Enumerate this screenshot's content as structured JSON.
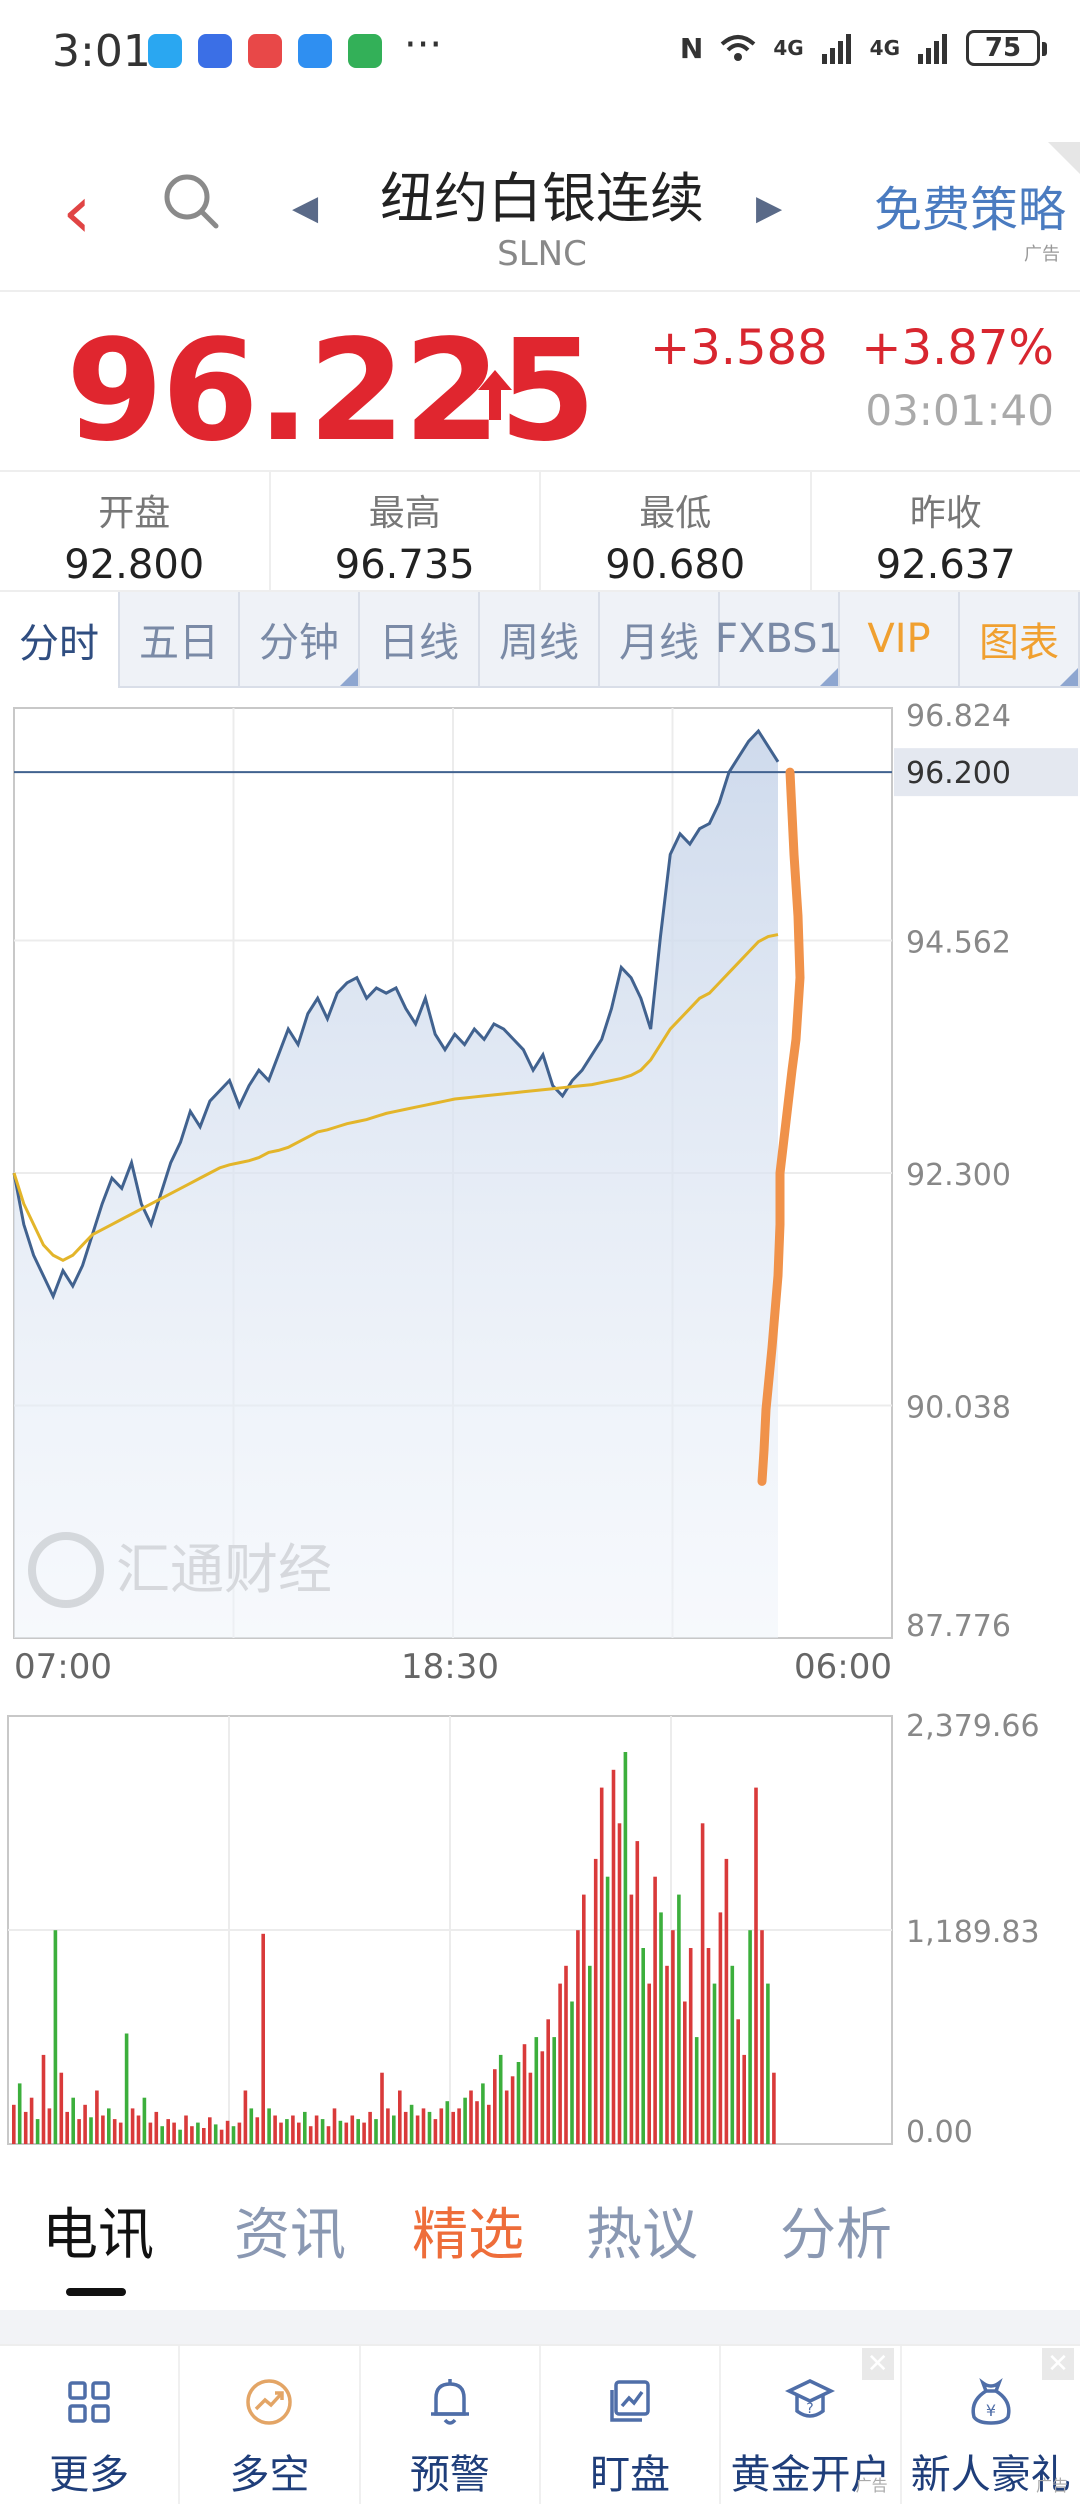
{
  "status": {
    "time": "3:01",
    "more": "···",
    "battery": "75",
    "signal_label": "4G",
    "app_colors": [
      "#2aa7f1",
      "#3b6fe6",
      "#e84848",
      "#2f8ff1",
      "#33b058"
    ]
  },
  "header": {
    "title": "纽约白银连续",
    "code": "SLNC",
    "promo": "免费策略",
    "promo_ad": "广告"
  },
  "quote": {
    "price": "96.225",
    "change": "+3.588",
    "change_pct": "+3.87%",
    "time": "03:01:40"
  },
  "stats": [
    {
      "label": "开盘",
      "value": "92.800"
    },
    {
      "label": "最高",
      "value": "96.735"
    },
    {
      "label": "最低",
      "value": "90.680"
    },
    {
      "label": "昨收",
      "value": "92.637"
    }
  ],
  "tabs": [
    {
      "label": "分时",
      "active": true
    },
    {
      "label": "五日"
    },
    {
      "label": "分钟",
      "corner": true
    },
    {
      "label": "日线"
    },
    {
      "label": "周线"
    },
    {
      "label": "月线"
    },
    {
      "label": "FXBS1",
      "corner": true
    },
    {
      "label": "VIP",
      "gold": true
    },
    {
      "label": "图表",
      "gold": true,
      "corner": true
    }
  ],
  "chart_data": [
    {
      "type": "line",
      "y_ticks": [
        "96.824",
        "94.562",
        "92.300",
        "90.038",
        "87.776"
      ],
      "ylim": [
        87.776,
        96.824
      ],
      "x_ticks": [
        "07:00",
        "18:30",
        "06:00"
      ],
      "current_line": {
        "value": 96.2,
        "label": "96.200"
      },
      "watermark": "汇通财经",
      "series": [
        {
          "color": "#41628f",
          "values": [
            92.3,
            91.8,
            91.5,
            91.3,
            91.1,
            91.35,
            91.2,
            91.4,
            91.7,
            92.0,
            92.25,
            92.15,
            92.4,
            92.0,
            91.8,
            92.1,
            92.4,
            92.6,
            92.9,
            92.75,
            93.0,
            93.1,
            93.2,
            92.95,
            93.15,
            93.3,
            93.2,
            93.45,
            93.7,
            93.55,
            93.85,
            94.0,
            93.8,
            94.05,
            94.15,
            94.2,
            94.0,
            94.1,
            94.05,
            94.1,
            93.9,
            93.75,
            94.0,
            93.65,
            93.5,
            93.65,
            93.55,
            93.7,
            93.6,
            93.75,
            93.7,
            93.6,
            93.5,
            93.3,
            93.45,
            93.15,
            93.05,
            93.2,
            93.3,
            93.45,
            93.6,
            93.9,
            94.3,
            94.2,
            94.0,
            93.7,
            94.6,
            95.4,
            95.6,
            95.5,
            95.65,
            95.7,
            95.9,
            96.2,
            96.35,
            96.5,
            96.6,
            96.45,
            96.3
          ]
        },
        {
          "color": "#e3b52a",
          "values": [
            92.3,
            92.0,
            91.8,
            91.6,
            91.5,
            91.45,
            91.5,
            91.6,
            91.7,
            91.75,
            91.8,
            91.85,
            91.9,
            91.95,
            92.0,
            92.05,
            92.1,
            92.15,
            92.2,
            92.25,
            92.3,
            92.35,
            92.38,
            92.4,
            92.42,
            92.45,
            92.5,
            92.52,
            92.55,
            92.6,
            92.65,
            92.7,
            92.72,
            92.75,
            92.78,
            92.8,
            92.82,
            92.85,
            92.88,
            92.9,
            92.92,
            92.94,
            92.96,
            92.98,
            93.0,
            93.02,
            93.03,
            93.04,
            93.05,
            93.06,
            93.07,
            93.08,
            93.09,
            93.1,
            93.11,
            93.12,
            93.13,
            93.14,
            93.15,
            93.16,
            93.18,
            93.2,
            93.22,
            93.25,
            93.3,
            93.4,
            93.55,
            93.7,
            93.8,
            93.9,
            94.0,
            94.05,
            94.15,
            94.25,
            94.35,
            94.45,
            94.55,
            94.6,
            94.62
          ]
        },
        {
          "color": "#f0924a",
          "values": [
            96.2,
            95.4,
            94.8,
            94.2,
            93.6,
            93.3,
            92.8,
            92.3,
            91.8,
            91.3,
            90.6,
            90.0,
            89.6,
            89.3
          ]
        }
      ]
    },
    {
      "type": "bar",
      "y_ticks": [
        "2,379.66",
        "1,189.83",
        "0.00"
      ],
      "ylim": [
        0,
        2379.66
      ],
      "up_color": "#d93a3a",
      "down_color": "#3caf3c",
      "values": [
        220,
        340,
        180,
        260,
        140,
        500,
        200,
        1200,
        400,
        180,
        260,
        140,
        220,
        150,
        300,
        160,
        200,
        140,
        120,
        620,
        200,
        160,
        260,
        120,
        180,
        100,
        140,
        120,
        80,
        160,
        100,
        120,
        90,
        150,
        110,
        80,
        130,
        100,
        120,
        300,
        200,
        150,
        1180,
        200,
        160,
        120,
        140,
        160,
        120,
        180,
        100,
        160,
        140,
        100,
        200,
        130,
        120,
        160,
        140,
        120,
        180,
        140,
        400,
        200,
        160,
        300,
        180,
        220,
        160,
        200,
        180,
        140,
        200,
        240,
        180,
        200,
        260,
        300,
        240,
        340,
        220,
        420,
        500,
        300,
        380,
        460,
        560,
        400,
        600,
        520,
        700,
        600,
        900,
        1000,
        800,
        1200,
        1400,
        1000,
        1600,
        2000,
        1500,
        2100,
        1800,
        2200,
        1400,
        1700,
        1100,
        900,
        1500,
        1300,
        1000,
        1200,
        1400,
        800,
        1100,
        600,
        1800,
        1100,
        900,
        1300,
        1600,
        1000,
        700,
        500,
        1200,
        2000,
        1200,
        900,
        400
      ]
    }
  ],
  "news_tabs": [
    "电讯",
    "资讯",
    "精选",
    "热议",
    "分析"
  ],
  "toolbar": [
    {
      "label": "更多",
      "icon": "grid-icon"
    },
    {
      "label": "多空",
      "icon": "trend-circle-icon"
    },
    {
      "label": "预警",
      "icon": "bell-icon"
    },
    {
      "label": "盯盘",
      "icon": "chart-board-icon"
    },
    {
      "label": "黄金开户",
      "icon": "mortarboard-icon",
      "ad": "广告",
      "close": "✕"
    },
    {
      "label": "新人豪礼",
      "icon": "money-bag-icon",
      "ad": "广告",
      "close": "✕"
    }
  ]
}
